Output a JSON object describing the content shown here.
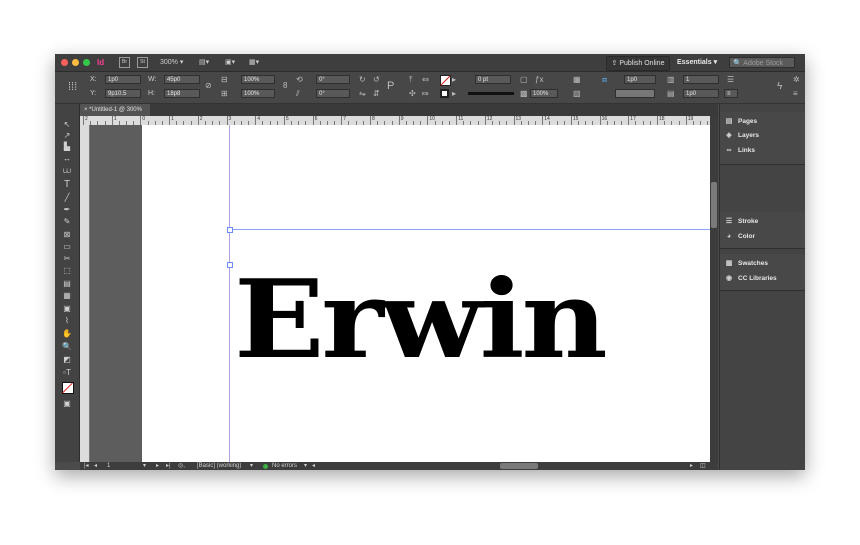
{
  "app": {
    "logo": "Id",
    "mode_icons": [
      "Br",
      "St"
    ]
  },
  "titlebar": {
    "zoom": "300%",
    "publish_label": "Publish Online",
    "workspace": "Essentials",
    "search_placeholder": "Adobe Stock"
  },
  "control": {
    "x_label": "X:",
    "x_value": "1p0",
    "y_label": "Y:",
    "y_value": "9p10.5",
    "w_label": "W:",
    "w_value": "45p0",
    "h_label": "H:",
    "h_value": "18p8",
    "scale_x": "100%",
    "scale_y": "100%",
    "rotate": "0°",
    "shear": "0°",
    "stroke_weight": "0 pt",
    "opacity": "100%",
    "gutter": "1p0",
    "columns": "1",
    "inset": "1p0",
    "inset2": "1p0"
  },
  "document": {
    "tab_label": "*Untitled-1 @ 300%",
    "artwork_text": "Erwin"
  },
  "ruler": {
    "labels": [
      "2",
      "1",
      "0",
      "1",
      "2",
      "3",
      "4",
      "5",
      "6",
      "7",
      "8",
      "9",
      "10",
      "11",
      "12",
      "13",
      "14",
      "15",
      "16",
      "17",
      "18",
      "19"
    ]
  },
  "status": {
    "page": "1",
    "style": "[Basic] (working)",
    "errors": "No errors"
  },
  "panel": {
    "groups": [
      {
        "items": [
          {
            "label": "Pages",
            "icon": "pages-icon"
          },
          {
            "label": "Layers",
            "icon": "layers-icon"
          },
          {
            "label": "Links",
            "icon": "links-icon"
          }
        ]
      },
      {
        "items": [
          {
            "label": "Stroke",
            "icon": "stroke-icon"
          },
          {
            "label": "Color",
            "icon": "color-icon"
          }
        ]
      },
      {
        "items": [
          {
            "label": "Swatches",
            "icon": "swatches-icon"
          },
          {
            "label": "CC Libraries",
            "icon": "cc-libraries-icon"
          }
        ]
      }
    ]
  },
  "colors": {
    "logo": "#ff3f94",
    "guide": "#a78bfa",
    "frame": "#6b8cff",
    "status_ok": "#3cb043"
  }
}
